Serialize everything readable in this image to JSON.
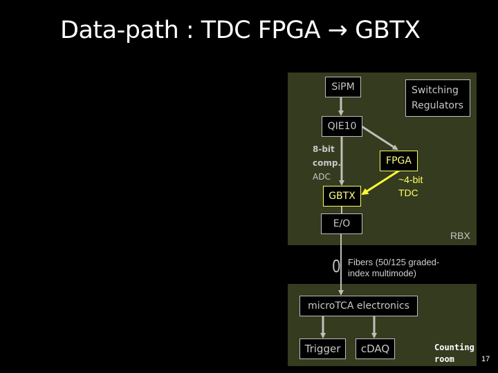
{
  "title": "Data-path : TDC FPGA → GBTX",
  "rbx_panel": {
    "label": "RBX",
    "boxes": {
      "sipm": "SiPM",
      "switching_regulators": [
        "Switching",
        "Regulators"
      ],
      "qie10": "QIE10",
      "fpga": "FPGA",
      "gbtx": "GBTX",
      "eo": "E/O"
    },
    "adc_label": [
      "8-bit",
      "comp.",
      "ADC"
    ],
    "tdc_label": [
      "~4-bit",
      "TDC"
    ]
  },
  "fibers": {
    "symbol": "0",
    "label": [
      "Fibers (50/125 graded-",
      "index multimode)"
    ]
  },
  "counting_room_panel": {
    "label": [
      "Counting",
      "room"
    ],
    "boxes": {
      "microtca": "microTCA electronics",
      "trigger": "Trigger",
      "cdaq": "cDAQ"
    }
  },
  "colors": {
    "panel_bg": "#343b1f",
    "gray_arrow": "#c0c0b8",
    "yellow_arrow": "#ffff33"
  },
  "page_number": "17"
}
